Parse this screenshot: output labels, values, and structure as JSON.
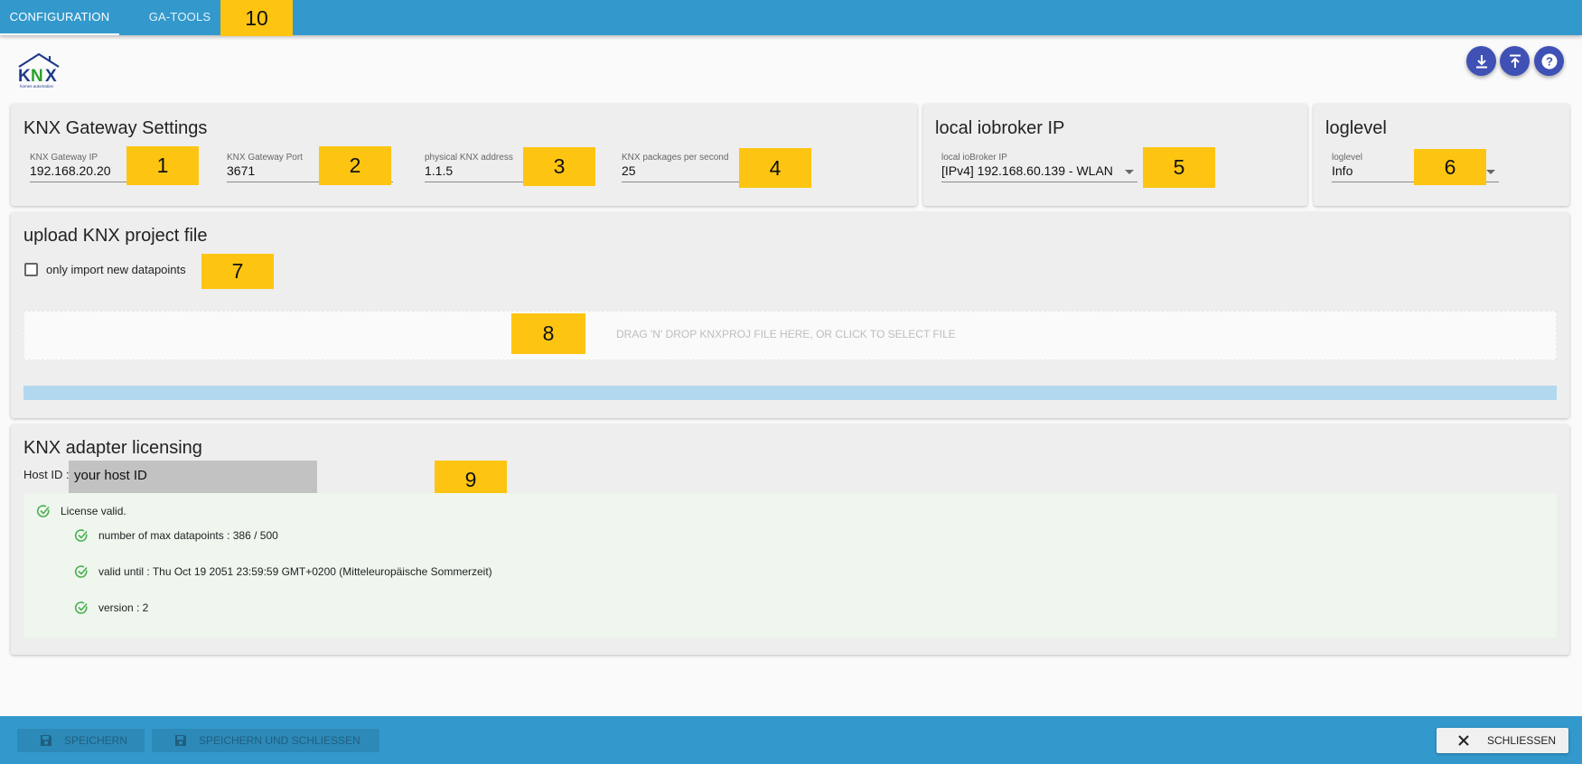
{
  "tabs": [
    {
      "label": "CONFIGURATION"
    },
    {
      "label": "GA-TOOLS"
    }
  ],
  "markers": [
    "1",
    "2",
    "3",
    "4",
    "5",
    "6",
    "7",
    "8",
    "9",
    "10"
  ],
  "logo": {
    "text": "KNX",
    "subtext": "homes automation"
  },
  "actions": {
    "download_icon": "download-icon",
    "upload_icon": "upload-icon",
    "help_icon": "help-icon"
  },
  "gateway": {
    "title": "KNX Gateway Settings",
    "ip": {
      "label": "KNX Gateway IP",
      "value": "192.168.20.20"
    },
    "port": {
      "label": "KNX Gateway Port",
      "value": "3671"
    },
    "phys": {
      "label": "physical KNX address",
      "value": "1.1.5"
    },
    "pps": {
      "label": "KNX packages per second",
      "value": "25"
    }
  },
  "local_ip": {
    "title": "local iobroker IP",
    "label": "local ioBroker IP",
    "value": "[IPv4] 192.168.60.139 - WLAN"
  },
  "loglevel": {
    "title": "loglevel",
    "label": "loglevel",
    "value": "Info"
  },
  "upload": {
    "title": "upload KNX project file",
    "checkbox_label": "only import new datapoints",
    "checkbox_checked": false,
    "dropzone_text": "DRAG 'N' DROP KNXPROJ FILE HERE, OR CLICK TO SELECT FILE"
  },
  "licensing": {
    "title": "KNX adapter licensing",
    "host_label": "Host ID :",
    "host_value": "your host ID",
    "status": "License valid.",
    "details": [
      "number of max datapoints : 386 / 500",
      "valid until : Thu Oct 19 2051 23:59:59 GMT+0200 (Mitteleuropäische Sommerzeit)",
      "version : 2"
    ]
  },
  "footer": {
    "save": "SPEICHERN",
    "save_close": "SPEICHERN UND SCHLIESSEN",
    "close": "SCHLIESSEN"
  },
  "colors": {
    "appbar": "#3399cc",
    "accent": "#3f51b5",
    "marker": "#fdc512",
    "license_bg": "#eef6ee",
    "check_green": "#4caf50"
  }
}
